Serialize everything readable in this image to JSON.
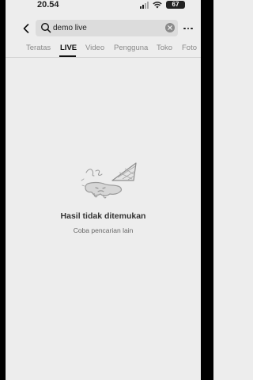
{
  "status_bar": {
    "time": "20.54",
    "battery": "67"
  },
  "search": {
    "query": "demo live",
    "icons": {
      "back": "chevron-left-icon",
      "search": "search-icon",
      "clear": "clear-icon",
      "more": "more-horizontal-icon"
    }
  },
  "tabs": [
    {
      "label": "Teratas"
    },
    {
      "label": "LIVE",
      "active": true
    },
    {
      "label": "Video"
    },
    {
      "label": "Pengguna"
    },
    {
      "label": "Toko"
    },
    {
      "label": "Foto"
    }
  ],
  "empty_state": {
    "title": "Hasil tidak ditemukan",
    "subtitle": "Coba pencarian lain",
    "illustration": "melted-ice-cream-illustration"
  },
  "colors": {
    "background": "#ededed",
    "text_primary": "#111111",
    "text_secondary": "#8a8a8a"
  }
}
